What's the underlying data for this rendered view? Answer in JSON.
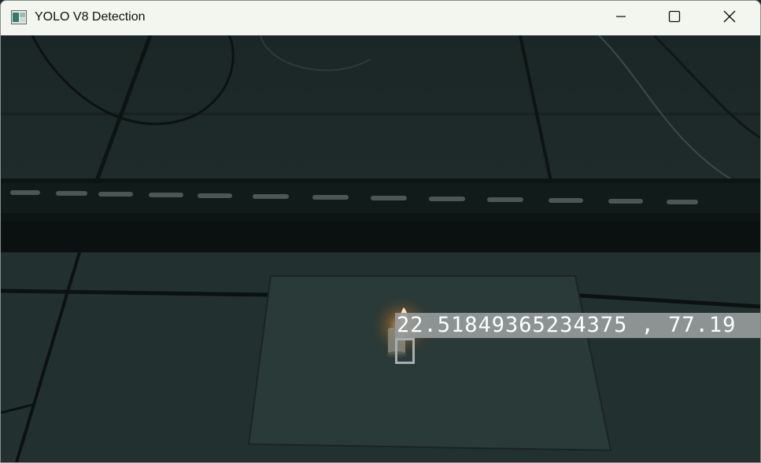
{
  "window": {
    "title": "YOLO V8 Detection",
    "controls": {
      "minimize_icon": "minimize-icon",
      "maximize_icon": "maximize-icon",
      "close_icon": "close-icon"
    }
  },
  "video": {
    "detection": {
      "label": "22.51849365234375 , 77.19",
      "box_color": "#a9aeae",
      "label_bg_color": "#969b9b"
    }
  }
}
